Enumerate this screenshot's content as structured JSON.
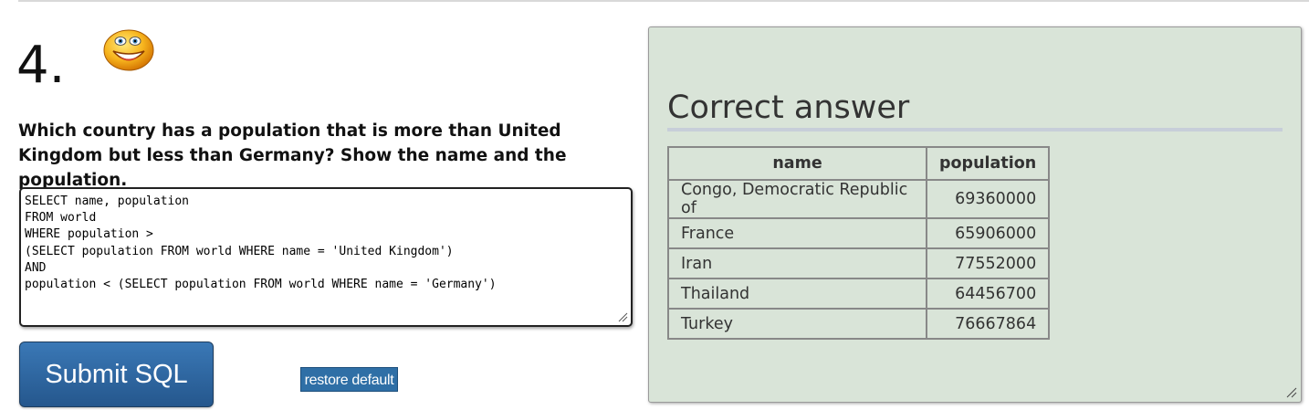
{
  "question": {
    "number": "4.",
    "text": "Which country has a population that is more than United Kingdom but less than Germany? Show the name and the population.",
    "status_icon": "smiley-face-icon"
  },
  "editor": {
    "sql": "SELECT name, population\nFROM world\nWHERE population >\n(SELECT population FROM world WHERE name = 'United Kingdom')\nAND\npopulation < (SELECT population FROM world WHERE name = 'Germany')"
  },
  "buttons": {
    "submit_label": "Submit SQL",
    "restore_label": "restore default"
  },
  "answer": {
    "title": "Correct answer",
    "columns": [
      "name",
      "population"
    ],
    "rows": [
      {
        "name": "Congo, Democratic Republic of",
        "population": "69360000"
      },
      {
        "name": "France",
        "population": "65906000"
      },
      {
        "name": "Iran",
        "population": "77552000"
      },
      {
        "name": "Thailand",
        "population": "64456700"
      },
      {
        "name": "Turkey",
        "population": "76667864"
      }
    ]
  },
  "colors": {
    "panel_background": "#d9e4d8",
    "button_blue": "#2f6fa6"
  }
}
